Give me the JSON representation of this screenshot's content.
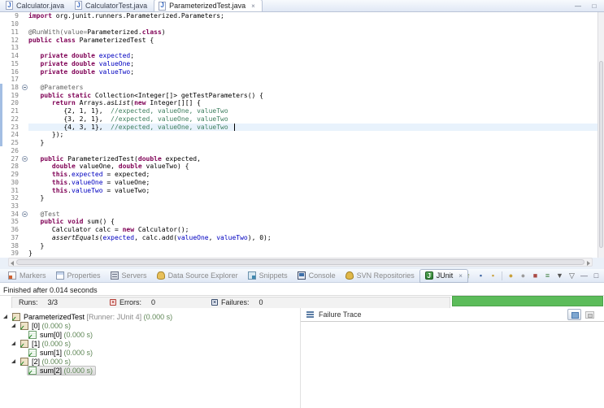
{
  "editor_tabs": [
    {
      "label": "Calculator.java",
      "active": false
    },
    {
      "label": "CalculatorTest.java",
      "active": false
    },
    {
      "label": "ParameterizedTest.java",
      "active": true,
      "close": "×"
    }
  ],
  "editor_controls": {
    "minimize": "—",
    "maximize": "□"
  },
  "editor": {
    "lines": [
      {
        "n": 9,
        "seg": [
          [
            "k",
            "import "
          ],
          [
            "p",
            "org.junit.runners.Parameterized.Parameters;"
          ]
        ]
      },
      {
        "n": 10,
        "seg": []
      },
      {
        "n": 11,
        "seg": [
          [
            "a",
            "@RunWith(value="
          ],
          [
            "p",
            "Parameterized."
          ],
          [
            "k",
            "class"
          ],
          [
            "p",
            ")"
          ]
        ]
      },
      {
        "n": 12,
        "seg": [
          [
            "k",
            "public class "
          ],
          [
            "p",
            "ParameterizedTest {"
          ]
        ]
      },
      {
        "n": 13,
        "seg": []
      },
      {
        "n": 14,
        "seg": [
          [
            "p",
            "   "
          ],
          [
            "k",
            "private double "
          ],
          [
            "f",
            "expected"
          ],
          [
            "p",
            ";"
          ]
        ]
      },
      {
        "n": 15,
        "seg": [
          [
            "p",
            "   "
          ],
          [
            "k",
            "private double "
          ],
          [
            "f",
            "valueOne"
          ],
          [
            "p",
            ";"
          ]
        ]
      },
      {
        "n": 16,
        "seg": [
          [
            "p",
            "   "
          ],
          [
            "k",
            "private double "
          ],
          [
            "f",
            "valueTwo"
          ],
          [
            "p",
            ";"
          ]
        ]
      },
      {
        "n": 17,
        "seg": []
      },
      {
        "n": 18,
        "fold": true,
        "changed": true,
        "seg": [
          [
            "p",
            "   "
          ],
          [
            "a",
            "@Parameters"
          ]
        ]
      },
      {
        "n": 19,
        "changed": true,
        "seg": [
          [
            "p",
            "   "
          ],
          [
            "k",
            "public static "
          ],
          [
            "p",
            "Collection<Integer[]> getTestParameters() {"
          ]
        ]
      },
      {
        "n": 20,
        "changed": true,
        "seg": [
          [
            "p",
            "      "
          ],
          [
            "k",
            "return "
          ],
          [
            "p",
            "Arrays."
          ],
          [
            "i",
            "asList"
          ],
          [
            "p",
            "("
          ],
          [
            "k",
            "new "
          ],
          [
            "p",
            "Integer[][] {"
          ]
        ]
      },
      {
        "n": 21,
        "changed": true,
        "seg": [
          [
            "p",
            "         {2, 1, 1},  "
          ],
          [
            "c",
            "//expected, valueOne, valueTwo"
          ]
        ]
      },
      {
        "n": 22,
        "changed": true,
        "seg": [
          [
            "p",
            "         {3, 2, 1},  "
          ],
          [
            "c",
            "//expected, valueOne, valueTwo"
          ]
        ]
      },
      {
        "n": 23,
        "changed": true,
        "current": true,
        "caret": true,
        "seg": [
          [
            "p",
            "         {4, 3, 1},  "
          ],
          [
            "c",
            "//expected, valueOne, valueTwo"
          ]
        ]
      },
      {
        "n": 24,
        "changed": true,
        "seg": [
          [
            "p",
            "      });"
          ]
        ]
      },
      {
        "n": 25,
        "changed": true,
        "seg": [
          [
            "p",
            "   }"
          ]
        ]
      },
      {
        "n": 26,
        "seg": []
      },
      {
        "n": 27,
        "fold": true,
        "seg": [
          [
            "p",
            "   "
          ],
          [
            "k",
            "public "
          ],
          [
            "p",
            "ParameterizedTest("
          ],
          [
            "k",
            "double "
          ],
          [
            "p",
            "expected,"
          ]
        ]
      },
      {
        "n": 28,
        "seg": [
          [
            "p",
            "      "
          ],
          [
            "k",
            "double "
          ],
          [
            "p",
            "valueOne, "
          ],
          [
            "k",
            "double "
          ],
          [
            "p",
            "valueTwo) {"
          ]
        ]
      },
      {
        "n": 29,
        "seg": [
          [
            "p",
            "      "
          ],
          [
            "k",
            "this"
          ],
          [
            "p",
            "."
          ],
          [
            "f",
            "expected"
          ],
          [
            "p",
            " = expected;"
          ]
        ]
      },
      {
        "n": 30,
        "seg": [
          [
            "p",
            "      "
          ],
          [
            "k",
            "this"
          ],
          [
            "p",
            "."
          ],
          [
            "f",
            "valueOne"
          ],
          [
            "p",
            " = valueOne;"
          ]
        ]
      },
      {
        "n": 31,
        "seg": [
          [
            "p",
            "      "
          ],
          [
            "k",
            "this"
          ],
          [
            "p",
            "."
          ],
          [
            "f",
            "valueTwo"
          ],
          [
            "p",
            " = valueTwo;"
          ]
        ]
      },
      {
        "n": 32,
        "seg": [
          [
            "p",
            "   }"
          ]
        ]
      },
      {
        "n": 33,
        "seg": []
      },
      {
        "n": 34,
        "fold": true,
        "seg": [
          [
            "p",
            "   "
          ],
          [
            "a",
            "@Test"
          ]
        ]
      },
      {
        "n": 35,
        "seg": [
          [
            "p",
            "   "
          ],
          [
            "k",
            "public void "
          ],
          [
            "p",
            "sum() {"
          ]
        ]
      },
      {
        "n": 36,
        "seg": [
          [
            "p",
            "      Calculator calc = "
          ],
          [
            "k",
            "new"
          ],
          [
            "p",
            " Calculator();"
          ]
        ]
      },
      {
        "n": 37,
        "seg": [
          [
            "p",
            "      "
          ],
          [
            "i",
            "assertEquals"
          ],
          [
            "p",
            "("
          ],
          [
            "f",
            "expected"
          ],
          [
            "p",
            ", calc.add("
          ],
          [
            "f",
            "valueOne"
          ],
          [
            "p",
            ", "
          ],
          [
            "f",
            "valueTwo"
          ],
          [
            "p",
            "), 0);"
          ]
        ]
      },
      {
        "n": 38,
        "seg": [
          [
            "p",
            "   }"
          ]
        ]
      },
      {
        "n": 39,
        "seg": [
          [
            "p",
            "}"
          ]
        ]
      }
    ]
  },
  "bottom_tabs": [
    {
      "label": "Markers",
      "icon": "markers-icon"
    },
    {
      "label": "Properties",
      "icon": "properties-icon"
    },
    {
      "label": "Servers",
      "icon": "servers-icon"
    },
    {
      "label": "Data Source Explorer",
      "icon": "data-source-explorer-icon"
    },
    {
      "label": "Snippets",
      "icon": "snippets-icon"
    },
    {
      "label": "Console",
      "icon": "console-icon"
    },
    {
      "label": "SVN Repositories",
      "icon": "svn-repositories-icon"
    },
    {
      "label": "JUnit",
      "icon": "junit-icon",
      "active": true,
      "close": "×"
    }
  ],
  "junit": {
    "status": "Finished after 0.014 seconds",
    "runs_label": "Runs:",
    "runs_value": "3/3",
    "errors_label": "Errors:",
    "errors_value": "0",
    "errors_glyph": "×",
    "failures_label": "Failures:",
    "failures_value": "0",
    "failures_glyph": "×",
    "progress_color": "#5CBC5A",
    "toolbar": [
      {
        "name": "show-next-failed-test-button",
        "glyph": "↑",
        "color": "#87935B"
      },
      {
        "name": "show-failures-only-button",
        "glyph": "▪",
        "color": "#3A62A0"
      },
      {
        "name": "scroll-lock-button",
        "glyph": "▪",
        "color": "#C9A13B"
      },
      {
        "name": "separator",
        "glyph": "",
        "color": ""
      },
      {
        "name": "rerun-test-button",
        "glyph": "●",
        "color": "#C9A13B"
      },
      {
        "name": "rerun-failed-tests-button",
        "glyph": "●",
        "color": "#9C9C9C"
      },
      {
        "name": "stop-test-run-button",
        "glyph": "■",
        "color": "#A94A44"
      },
      {
        "name": "test-run-history-button",
        "glyph": "≡",
        "color": "#3F7F3F"
      },
      {
        "name": "history-dropdown-icon",
        "glyph": "▼",
        "color": "#555555"
      },
      {
        "name": "view-menu-button",
        "glyph": "▽",
        "color": "#555555"
      },
      {
        "name": "minimize-view-button",
        "glyph": "—",
        "color": "#555566"
      },
      {
        "name": "maximize-view-button",
        "glyph": "□",
        "color": "#555566"
      }
    ],
    "tree": [
      {
        "level": 0,
        "icon": "suite",
        "expanded": true,
        "label": "ParameterizedTest",
        "qualifier": " [Runner: JUnit 4]",
        "time": " (0.000 s)",
        "selected": false
      },
      {
        "level": 1,
        "icon": "suite",
        "expanded": true,
        "label": "[0]",
        "qualifier": "",
        "time": " (0.000 s)",
        "selected": false
      },
      {
        "level": 2,
        "icon": "test",
        "label": "sum[0]",
        "qualifier": "",
        "time": " (0.000 s)",
        "selected": false
      },
      {
        "level": 1,
        "icon": "suite",
        "expanded": true,
        "label": "[1]",
        "qualifier": "",
        "time": " (0.000 s)",
        "selected": false
      },
      {
        "level": 2,
        "icon": "test",
        "label": "sum[1]",
        "qualifier": "",
        "time": " (0.000 s)",
        "selected": false
      },
      {
        "level": 1,
        "icon": "suite",
        "expanded": true,
        "label": "[2]",
        "qualifier": "",
        "time": " (0.000 s)",
        "selected": false
      },
      {
        "level": 2,
        "icon": "test",
        "label": "sum[2]",
        "qualifier": "",
        "time": " (0.000 s)",
        "selected": true
      }
    ],
    "failure_trace_title": "Failure Trace"
  }
}
